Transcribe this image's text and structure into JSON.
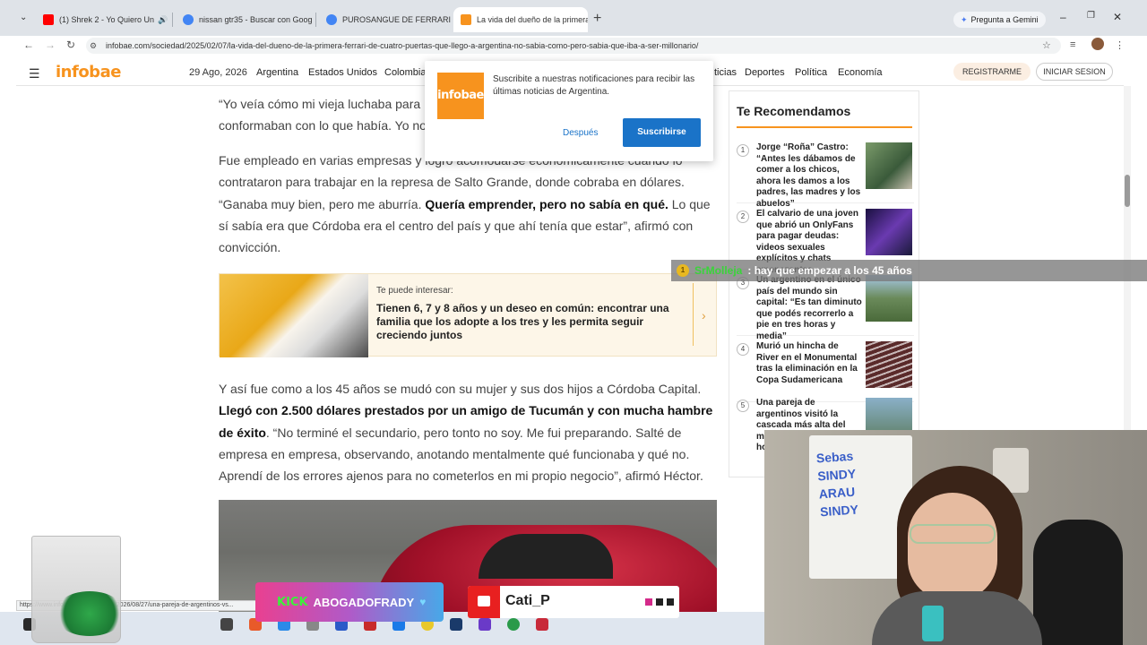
{
  "browser": {
    "tabs": [
      {
        "title": "(1) Shrek 2 - Yo Quiero Un",
        "favicon_color": "#ff0000"
      },
      {
        "title": "nissan gtr35 - Buscar con Goog",
        "favicon_color": "#4285f4"
      },
      {
        "title": "PUROSANGUE DE FERRARI CON",
        "favicon_color": "#4285f4"
      },
      {
        "title": "La vida del dueño de la primera",
        "favicon_color": "#f7931e"
      }
    ],
    "gemini_label": "Pregunta a Gemini",
    "url": "infobae.com/sociedad/2025/02/07/la-vida-del-dueno-de-la-primera-ferrari-de-cuatro-puertas-que-llego-a-argentina-no-sabia-como-pero-sabia-que-iba-a-ser-millonario/",
    "status_url": "https://www.infobae.com/sociedad/2026/08/27/una-pareja-de-argentinos-vs..."
  },
  "site": {
    "logo": "infobae",
    "date": "29 Ago, 2026",
    "nav": [
      "Argentina",
      "Estados Unidos",
      "Colombia",
      "ticias",
      "Deportes",
      "Política",
      "Economía"
    ],
    "register": "REGISTRARME",
    "login": "INICIAR SESION"
  },
  "article": {
    "p1": "“Yo veía cómo mi vieja luchaba para conformaban con lo que había. Yo no",
    "p2_a": "Fue empleado en varias empresas y logró acomodarse económicamente cuando lo contrataron para trabajar en la represa de Salto Grande, donde cobraba en dólares. “Ganaba muy bien, pero me aburría. ",
    "p2_b": "Quería emprender, pero no sabía en qué.",
    "p2_c": " Lo que sí sabía era que Córdoba era el centro del país y que ahí tenía que estar”, afirmó con convicción.",
    "promo_kicker": "Te puede interesar:",
    "promo_title": "Tienen 6, 7 y 8 años y un deseo en común: encontrar una familia que los adopte a los tres y les permita seguir creciendo juntos",
    "p3_a": "Y así fue como a los 45 años se mudó con su mujer y sus dos hijos a Córdoba Capital. ",
    "p3_b": "Llegó con 2.500 dólares prestados por un amigo de Tucumán y con mucha hambre de éxito",
    "p3_c": ". “No terminé el secundario, pero tonto no soy. Me fui preparando. Salté de empresa en empresa, observando, anotando mentalmente qué funcionaba y qué no. Aprendí de los errores ajenos para no cometerlos en mi propio negocio”, afirmó Héctor."
  },
  "sidebar": {
    "title": "Te Recomendamos",
    "items": [
      {
        "num": "1",
        "text": "Jorge “Roña” Castro: “Antes les dábamos de comer a los chicos, ahora les damos a los padres, las madres y los abuelos”",
        "color": "#5a7a4a"
      },
      {
        "num": "2",
        "text": "El calvario de una joven que abrió un OnlyFans para pagar deudas: videos sexuales explícitos y chats amenazantes",
        "color": "#3a2a6a"
      },
      {
        "num": "3",
        "text": "Un argentino en el único país del mundo sin capital: “Es tan diminuto que podés recorrerlo a pie en tres horas y media”",
        "color": "#6a8a6a"
      },
      {
        "num": "4",
        "text": "Murió un hincha de River en el Monumental tras la eliminación en la Copa Sudamericana",
        "color": "#7a3a3a"
      },
      {
        "num": "5",
        "text": "Una pareja de argentinos visitó la cascada más alta del mundo: “Fueron cinco ho un se",
        "color": "#5a7a8a"
      }
    ]
  },
  "notification": {
    "logo": "infobae",
    "text": "Suscribite a nuestras notificaciones para recibir las últimas noticias de Argentina.",
    "later": "Después",
    "subscribe": "Suscribirse"
  },
  "stream": {
    "chat_user": "SrMolleja",
    "chat_message": ": hay que empezar a los 45 años",
    "kick_logo": "KICK",
    "kick_name": "ABOGADOFRADY",
    "youtube_name": "Cati_P",
    "whiteboard": "Sebas\nSINDY\nARAU\nSINDY"
  }
}
